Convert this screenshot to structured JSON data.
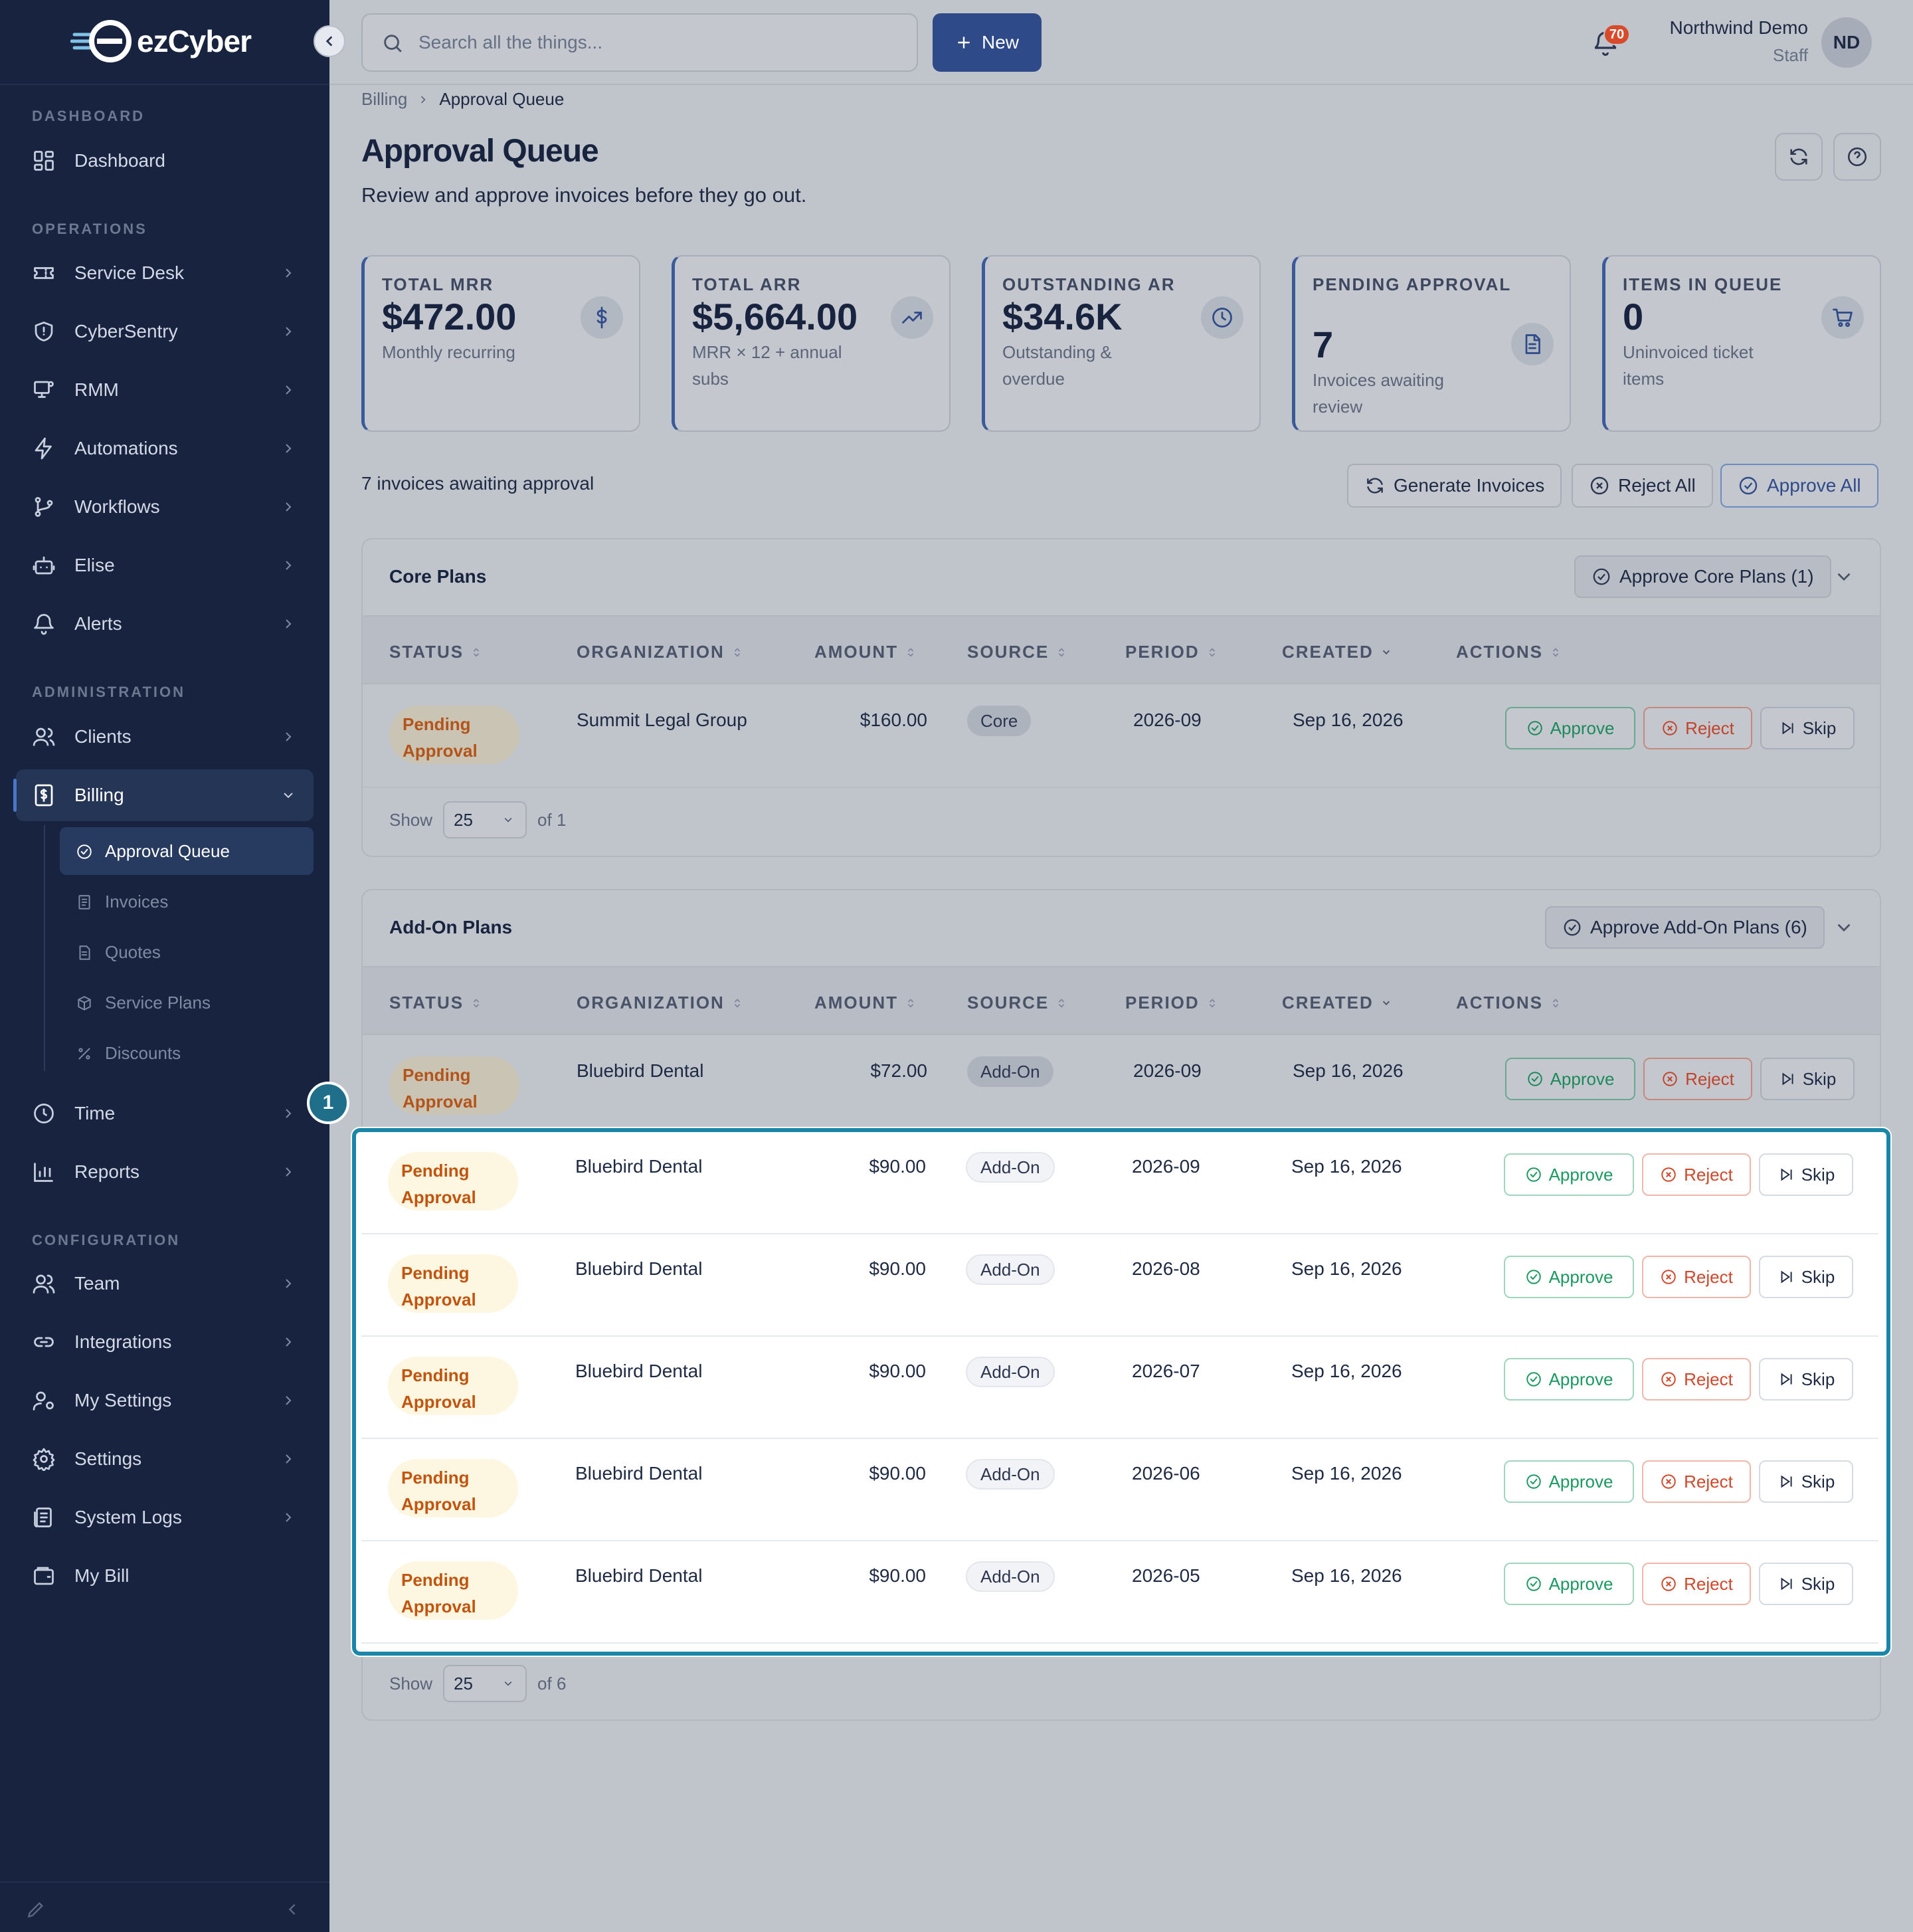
{
  "app": {
    "brand": "ezCyber",
    "accent": "#2e4a88",
    "highlight": "#1a86a8"
  },
  "sidebar": {
    "sections": {
      "dashboard": "DASHBOARD",
      "operations": "OPERATIONS",
      "administration": "ADMINISTRATION",
      "configuration": "CONFIGURATION"
    },
    "dashboard": "Dashboard",
    "ops": [
      {
        "label": "Service Desk",
        "icon": "ticket-icon"
      },
      {
        "label": "CyberSentry",
        "icon": "shield-icon"
      },
      {
        "label": "RMM",
        "icon": "monitor-icon"
      },
      {
        "label": "Automations",
        "icon": "bolt-icon"
      },
      {
        "label": "Workflows",
        "icon": "git-branch-icon"
      },
      {
        "label": "Elise",
        "icon": "robot-icon"
      },
      {
        "label": "Alerts",
        "icon": "bell-icon"
      }
    ],
    "clients": "Clients",
    "billing": "Billing",
    "billing_sub": [
      "Approval Queue",
      "Invoices",
      "Quotes",
      "Service Plans",
      "Discounts"
    ],
    "time": "Time",
    "reports": "Reports",
    "config": [
      {
        "label": "Team",
        "icon": "team-icon"
      },
      {
        "label": "Integrations",
        "icon": "link-icon"
      },
      {
        "label": "My Settings",
        "icon": "user-gear-icon"
      },
      {
        "label": "Settings",
        "icon": "gear-icon"
      },
      {
        "label": "System Logs",
        "icon": "logs-icon"
      },
      {
        "label": "My Bill",
        "icon": "wallet-icon"
      }
    ]
  },
  "topbar": {
    "search_placeholder": "Search all the things...",
    "new_label": "New",
    "notification_count": "70",
    "user_name": "Northwind Demo",
    "user_role": "Staff",
    "avatar_initials": "ND"
  },
  "breadcrumb": [
    "Billing",
    "Approval Queue"
  ],
  "page": {
    "title": "Approval Queue",
    "subtitle": "Review and approve invoices before they go out."
  },
  "stats": [
    {
      "label": "TOTAL MRR",
      "value": "$472.00",
      "desc": "Monthly recurring",
      "icon": "dollar-icon"
    },
    {
      "label": "TOTAL ARR",
      "value": "$5,664.00",
      "desc": "MRR × 12 + annual subs",
      "icon": "trend-up-icon"
    },
    {
      "label": "OUTSTANDING AR",
      "value": "$34.6K",
      "desc": "Outstanding & overdue",
      "icon": "clock-icon"
    },
    {
      "label": "PENDING APPROVAL",
      "value": "7",
      "desc": "Invoices awaiting review",
      "icon": "document-icon"
    },
    {
      "label": "ITEMS IN QUEUE",
      "value": "0",
      "desc": "Uninvoiced ticket items",
      "icon": "cart-icon"
    }
  ],
  "summary": {
    "count_text": "7 invoices awaiting approval",
    "generate": "Generate Invoices",
    "reject_all": "Reject All",
    "approve_all": "Approve All"
  },
  "columns": [
    "STATUS",
    "ORGANIZATION",
    "AMOUNT",
    "SOURCE",
    "PERIOD",
    "CREATED",
    "ACTIONS"
  ],
  "actions": {
    "approve": "Approve",
    "reject": "Reject",
    "skip": "Skip"
  },
  "status_text": "Pending Approval",
  "core": {
    "title": "Core Plans",
    "approve_group": "Approve Core Plans (1)",
    "rows": [
      {
        "org": "Summit Legal Group",
        "amount": "$160.00",
        "source": "Core",
        "period": "2026-09",
        "created": "Sep 16, 2026"
      }
    ],
    "pager": {
      "show": "Show",
      "size": "25",
      "of": "of 1"
    }
  },
  "addon": {
    "title": "Add-On Plans",
    "approve_group": "Approve Add-On Plans (6)",
    "rows": [
      {
        "org": "Bluebird Dental",
        "amount": "$72.00",
        "source": "Add-On",
        "period": "2026-09",
        "created": "Sep 16, 2026"
      },
      {
        "org": "Bluebird Dental",
        "amount": "$90.00",
        "source": "Add-On",
        "period": "2026-09",
        "created": "Sep 16, 2026"
      },
      {
        "org": "Bluebird Dental",
        "amount": "$90.00",
        "source": "Add-On",
        "period": "2026-08",
        "created": "Sep 16, 2026"
      },
      {
        "org": "Bluebird Dental",
        "amount": "$90.00",
        "source": "Add-On",
        "period": "2026-07",
        "created": "Sep 16, 2026"
      },
      {
        "org": "Bluebird Dental",
        "amount": "$90.00",
        "source": "Add-On",
        "period": "2026-06",
        "created": "Sep 16, 2026"
      },
      {
        "org": "Bluebird Dental",
        "amount": "$90.00",
        "source": "Add-On",
        "period": "2026-05",
        "created": "Sep 16, 2026"
      }
    ],
    "pager": {
      "show": "Show",
      "size": "25",
      "of": "of 6"
    }
  },
  "annotation": {
    "marker": "1"
  }
}
